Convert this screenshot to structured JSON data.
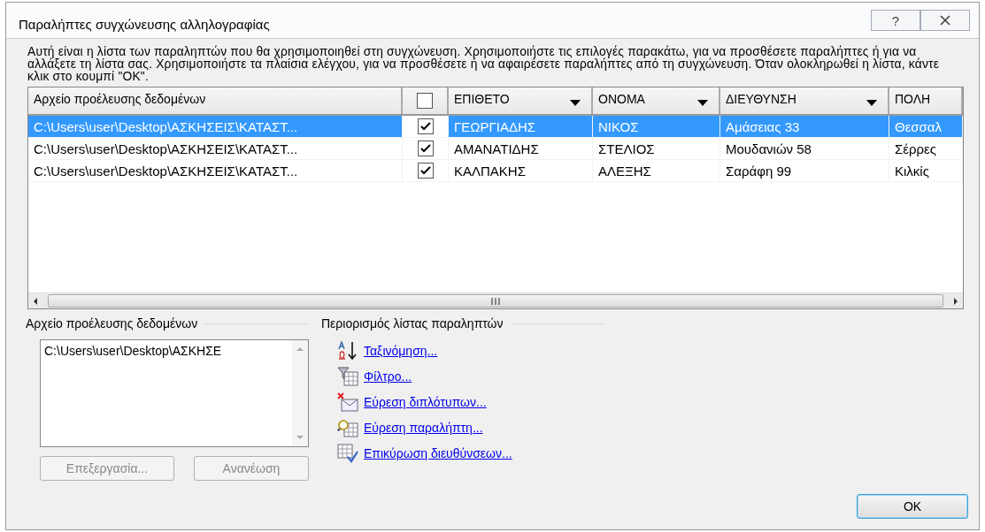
{
  "window": {
    "title": "Παραλήπτες συγχώνευσης αλληλογραφίας",
    "help": "?"
  },
  "description": "Αυτή είναι η λίστα των παραληπτών που θα χρησιμοποιηθεί στη συγχώνευση. Χρησιμοποιήστε τις επιλογές παρακάτω, για να προσθέσετε παραλήπτες ή για να αλλάξετε τη λίστα σας. Χρησιμοποιήστε τα πλαίσια ελέγχου, για να προσθέσετε ή να αφαιρέσετε παραλήπτες από τη συγχώνευση. Όταν ολοκληρωθεί η λίστα, κάντε κλικ στο κουμπί \"ΟΚ\".",
  "table": {
    "header_checked": false,
    "columns": [
      {
        "label": "Αρχείο προέλευσης δεδομένων",
        "dropdown": false
      },
      {
        "label": "ΕΠΙΘΕΤΟ",
        "dropdown": true
      },
      {
        "label": "ΟΝΟΜΑ",
        "dropdown": true
      },
      {
        "label": "ΔΙΕΥΘΥΝΣΗ",
        "dropdown": true
      },
      {
        "label": "ΠΟΛΗ",
        "dropdown": false
      }
    ],
    "rows": [
      {
        "selected": true,
        "checked": true,
        "cells": [
          "C:\\Users\\user\\Desktop\\ΑΣΚΗΣΕΙΣ\\ΚΑΤΑΣΤ...",
          "ΓΕΩΡΓΙΑΔΗΣ",
          "ΝΙΚΟΣ",
          "Αμάσειας 33",
          "Θεσσαλ"
        ]
      },
      {
        "selected": false,
        "checked": true,
        "cells": [
          "C:\\Users\\user\\Desktop\\ΑΣΚΗΣΕΙΣ\\ΚΑΤΑΣΤ...",
          "ΑΜΑΝΑΤΙΔΗΣ",
          "ΣΤΕΛΙΟΣ",
          "Μουδανιών 58",
          "Σέρρες"
        ]
      },
      {
        "selected": false,
        "checked": true,
        "cells": [
          "C:\\Users\\user\\Desktop\\ΑΣΚΗΣΕΙΣ\\ΚΑΤΑΣΤ...",
          "ΚΑΛΠΑΚΗΣ",
          "ΑΛΕΞΗΣ",
          "Σαράφη 99",
          "Κιλκίς"
        ]
      }
    ]
  },
  "source_group": {
    "title": "Αρχείο προέλευσης δεδομένων",
    "items": [
      {
        "label": "C:\\Users\\user\\Desktop\\ΑΣΚΗΣΕ",
        "selected": false
      }
    ],
    "buttons": [
      {
        "label": "Επεξεργασία...",
        "disabled": true
      },
      {
        "label": "Ανανέωση",
        "disabled": true
      }
    ]
  },
  "refine_group": {
    "title": "Περιορισμός λίστας παραληπτών",
    "links": [
      {
        "kind": "sort",
        "label": "Ταξινόμηση..."
      },
      {
        "kind": "filter",
        "label": "Φίλτρο..."
      },
      {
        "kind": "duplicates",
        "label": "Εύρεση διπλότυπων..."
      },
      {
        "kind": "find",
        "label": "Εύρεση παραλήπτη..."
      },
      {
        "kind": "validate",
        "label": "Επικύρωση διευθύνσεων..."
      }
    ]
  },
  "ok_button": "OK"
}
